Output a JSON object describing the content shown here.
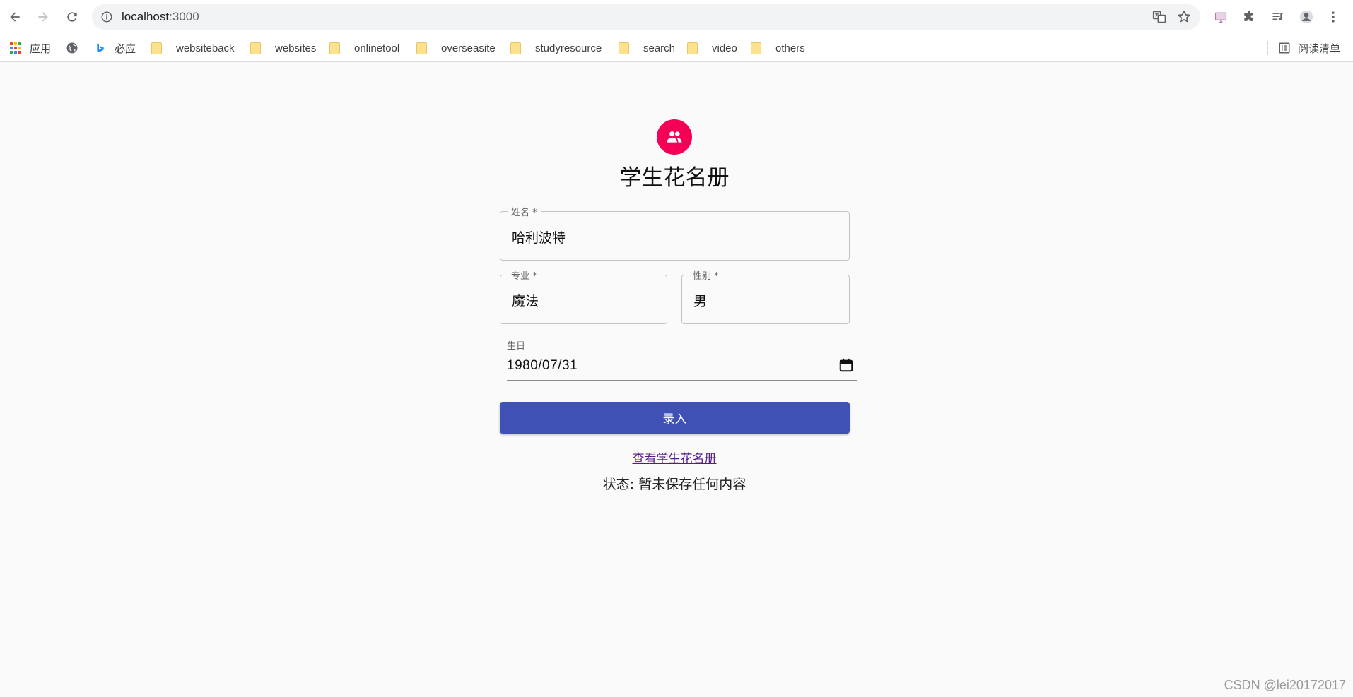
{
  "browser": {
    "url_host": "localhost",
    "url_port": ":3000",
    "bookmarks": [
      {
        "label": "应用",
        "type": "apps"
      },
      {
        "label": "",
        "type": "globe"
      },
      {
        "label": "必应",
        "type": "bing"
      },
      {
        "label": "websiteback",
        "type": "folder"
      },
      {
        "label": "websites",
        "type": "folder"
      },
      {
        "label": "onlinetool",
        "type": "folder"
      },
      {
        "label": "overseasite",
        "type": "folder"
      },
      {
        "label": "studyresource",
        "type": "folder"
      },
      {
        "label": "search",
        "type": "folder"
      },
      {
        "label": "video",
        "type": "folder"
      },
      {
        "label": "others",
        "type": "folder"
      }
    ],
    "reading_list": "阅读清单"
  },
  "form": {
    "title": "学生花名册",
    "name_label": "姓名 *",
    "name_value": "哈利波特",
    "major_label": "专业 *",
    "major_value": "魔法",
    "gender_label": "性别 *",
    "gender_value": "男",
    "birthday_label": "生日",
    "birthday_value": "1980/07/31",
    "submit_label": "录入",
    "view_link": "查看学生花名册",
    "status": "状态: 暂未保存任何内容"
  },
  "watermark": "CSDN @lei20172017",
  "colors": {
    "avatar": "#f50057",
    "primary": "#3f51b5",
    "link_visited": "#551a8b"
  }
}
